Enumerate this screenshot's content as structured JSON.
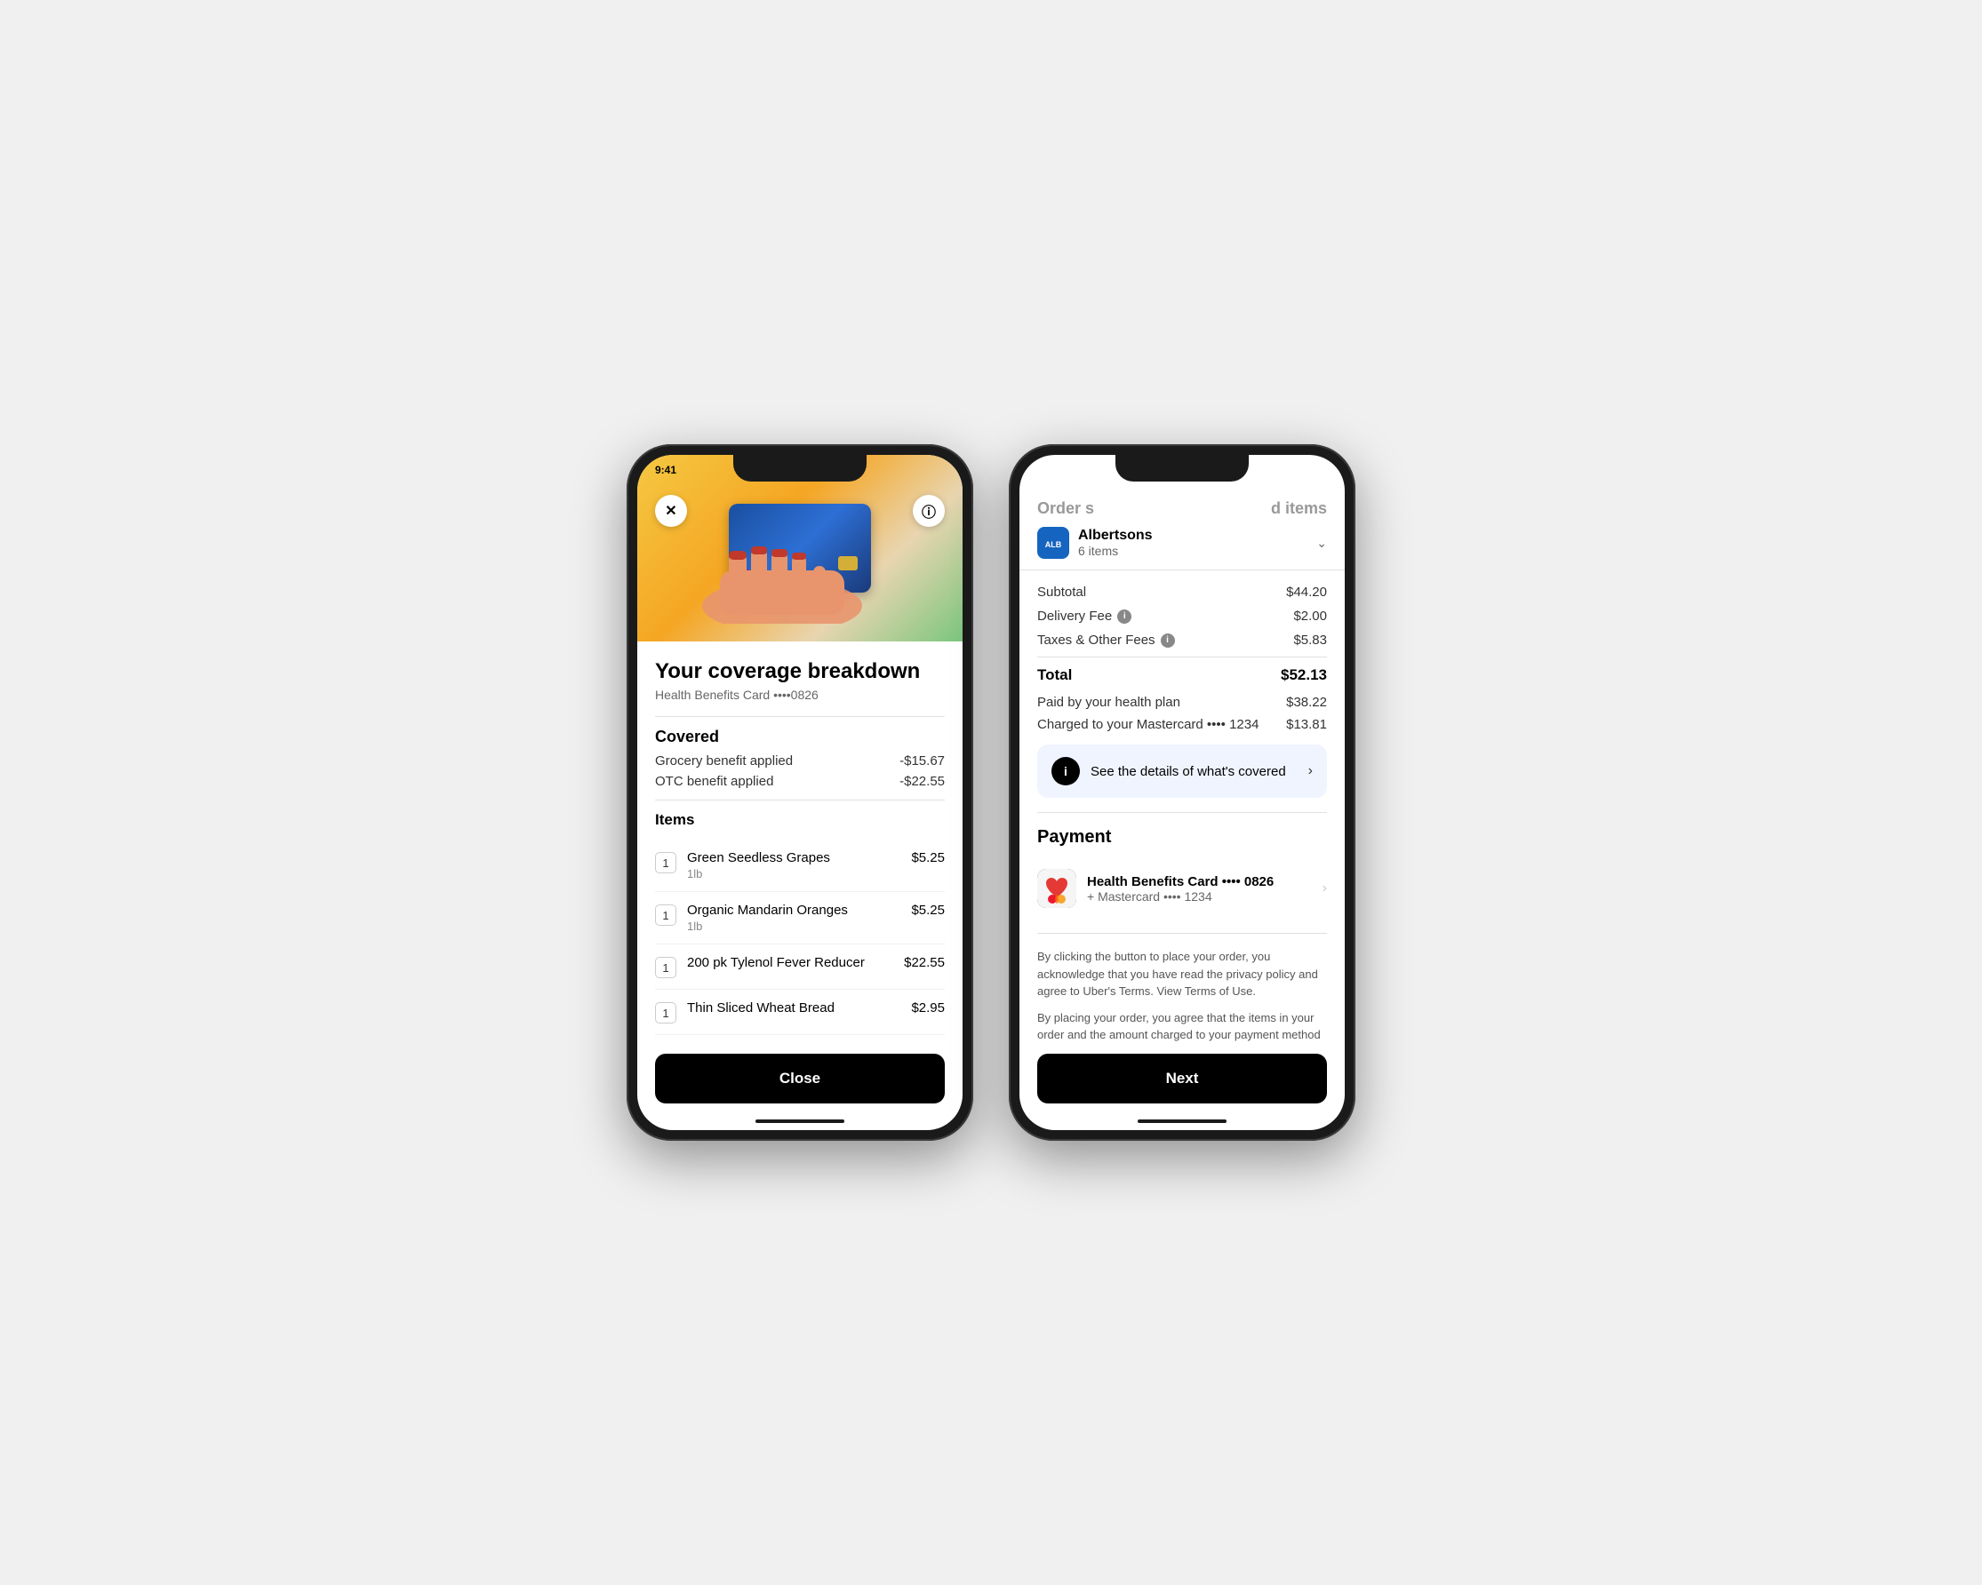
{
  "phone1": {
    "status_time": "9:41",
    "close_icon": "✕",
    "info_icon": "ⓘ",
    "coverage_title": "Your coverage breakdown",
    "coverage_subtitle": "Health Benefits Card ••••0826",
    "covered_section": {
      "title": "Covered",
      "benefits": [
        {
          "label": "Grocery benefit applied",
          "amount": "-$15.67"
        },
        {
          "label": "OTC benefit applied",
          "amount": "-$22.55"
        }
      ]
    },
    "items_section": {
      "title": "Items",
      "items": [
        {
          "qty": "1",
          "name": "Green Seedless Grapes",
          "weight": "1lb",
          "price": "$5.25"
        },
        {
          "qty": "1",
          "name": "Organic Mandarin Oranges",
          "weight": "1lb",
          "price": "$5.25"
        },
        {
          "qty": "1",
          "name": "200 pk Tylenol Fever Reducer",
          "weight": "",
          "price": "$22.55"
        },
        {
          "qty": "1",
          "name": "Thin Sliced Wheat Bread",
          "weight": "",
          "price": "$2.95"
        }
      ]
    },
    "close_button_label": "Close"
  },
  "phone2": {
    "header": {
      "title_left": "Order s",
      "title_right": "d items",
      "store_name": "Albertsons",
      "store_items": "6 items"
    },
    "order_summary": {
      "subtotal_label": "Subtotal",
      "subtotal_value": "$44.20",
      "delivery_fee_label": "Delivery Fee",
      "delivery_fee_value": "$2.00",
      "taxes_label": "Taxes & Other Fees",
      "taxes_value": "$5.83",
      "total_label": "Total",
      "total_value": "$52.13",
      "health_plan_label": "Paid by your health plan",
      "health_plan_value": "$38.22",
      "mastercard_label": "Charged to your Mastercard •••• 1234",
      "mastercard_value": "$13.81"
    },
    "see_details_text": "See the details of what's covered",
    "payment_section": {
      "title": "Payment",
      "card_name": "Health Benefits Card •••• 0826",
      "card_sub": "+ Mastercard •••• 1234"
    },
    "disclaimer1": "By clicking the button to place your order, you acknowledge that you have read the privacy policy and agree to Uber's Terms. View Terms of Use.",
    "disclaimer2": "By placing your order, you agree that the items in your order and the amount charged to your payment method are subject to change based on in-store item availability.",
    "next_button_label": "Next"
  }
}
